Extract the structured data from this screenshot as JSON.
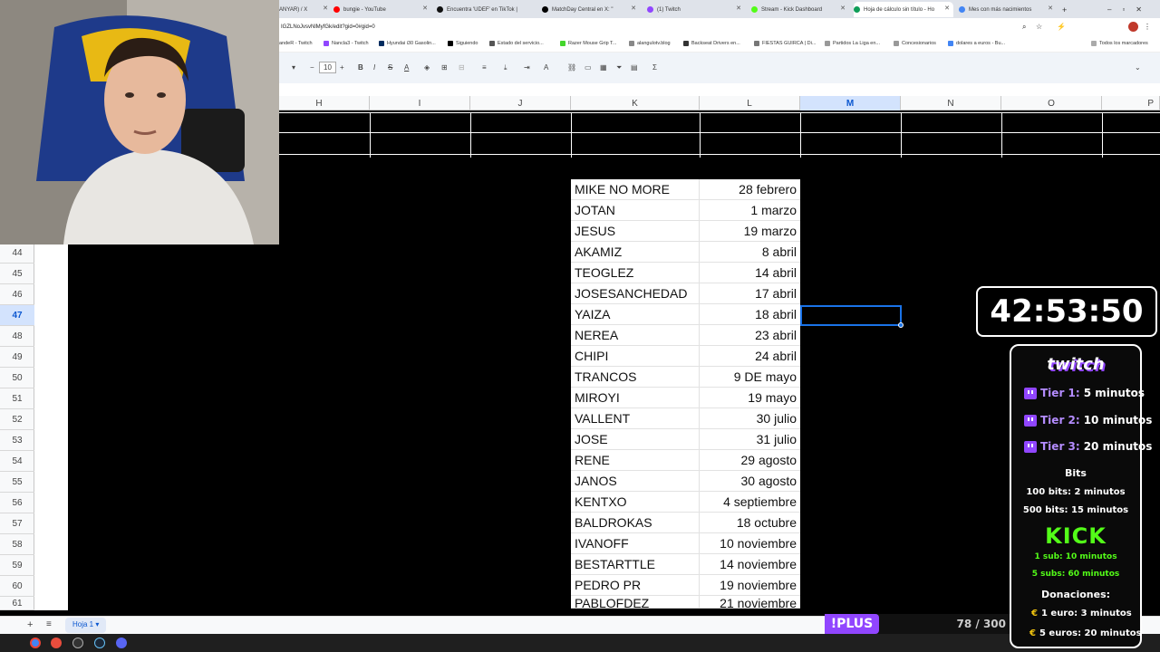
{
  "browser": {
    "tabs": [
      {
        "title": "ANYAR) / X",
        "color": "#000000"
      },
      {
        "title": "bungie - YouTube",
        "color": "#ff0000"
      },
      {
        "title": "Encuentra 'UDEF' en TikTok |",
        "color": "#111111"
      },
      {
        "title": "MatchDay Central en X: \"",
        "color": "#000000"
      },
      {
        "title": "(1) Twitch",
        "color": "#9146ff"
      },
      {
        "title": "Stream - Kick Dashboard",
        "color": "#53fc18"
      },
      {
        "title": "Hoja de cálculo sin título - Ho",
        "color": "#0f9d58"
      },
      {
        "title": "Mes con más nacimientos",
        "color": "#4285f4"
      }
    ],
    "url": "IGZLNoJvsvNlMyfGk/edit?gid=0#gid=0",
    "bookmarks": [
      "andeR - Twitch",
      "Nancla3 - Twitch",
      "Hyundai i30 Gasolin...",
      "Siguiendo",
      "Estado del servicio...",
      "Razer Mouse Grip T...",
      "alangulotv.blog",
      "Backseat Drivers en...",
      "FIESTAS GUIRCA | Di...",
      "Partidos La Liga en...",
      "Concesionarios",
      "dolares a euros - Bu..."
    ],
    "all_bookmarks": "Todos los marcadores"
  },
  "toolbar": {
    "font_size": "10"
  },
  "sheet": {
    "columns": [
      "H",
      "I",
      "J",
      "K",
      "L",
      "M",
      "N",
      "O",
      "P"
    ],
    "selected_column": "M",
    "row_numbers": [
      "44",
      "45",
      "46",
      "47",
      "48",
      "49",
      "50",
      "51",
      "52",
      "53",
      "54",
      "55",
      "56",
      "57",
      "58",
      "59",
      "60",
      "61"
    ],
    "selected_row": "47",
    "entries": [
      {
        "name": "MIKE NO MORE",
        "date": "28 febrero"
      },
      {
        "name": "JOTAN",
        "date": "1 marzo"
      },
      {
        "name": "JESUS",
        "date": "19 marzo"
      },
      {
        "name": "AKAMIZ",
        "date": "8 abril"
      },
      {
        "name": "TEOGLEZ",
        "date": "14 abril"
      },
      {
        "name": "JOSESANCHEDAD",
        "date": "17 abril"
      },
      {
        "name": "YAIZA",
        "date": "18 abril"
      },
      {
        "name": "NEREA",
        "date": "23 abril"
      },
      {
        "name": "CHIPI",
        "date": "24 abril"
      },
      {
        "name": "TRANCOS",
        "date": "9 DE mayo"
      },
      {
        "name": "MIROYI",
        "date": "19 mayo"
      },
      {
        "name": "VALLENT",
        "date": "30 julio"
      },
      {
        "name": "JOSE",
        "date": "31 julio"
      },
      {
        "name": "RENE",
        "date": "29 agosto"
      },
      {
        "name": "JANOS",
        "date": "30 agosto"
      },
      {
        "name": "KENTXO",
        "date": "4 septiembre"
      },
      {
        "name": "BALDROKAS",
        "date": "18 octubre"
      },
      {
        "name": "IVANOFF",
        "date": "10 noviembre"
      },
      {
        "name": "BESTARTTLE",
        "date": "14 noviembre"
      },
      {
        "name": "PEDRO PR",
        "date": "19 noviembre"
      },
      {
        "name": "PABLOFDEZ",
        "date": "21 noviembre"
      }
    ],
    "sheet_tab": "Hoja 1"
  },
  "overlay": {
    "timer": "42:53:50",
    "twitch_logo": "twitch",
    "tiers": [
      {
        "label": "Tier 1:",
        "value": "5 minutos"
      },
      {
        "label": "Tier 2:",
        "value": "10 minutos"
      },
      {
        "label": "Tier 3:",
        "value": "20 minutos"
      }
    ],
    "bits_title": "Bits",
    "bits": [
      "100 bits: 2 minutos",
      "500 bits: 15 minutos"
    ],
    "kick_logo": "KICK",
    "kick": [
      "1 sub: 10 minutos",
      "5 subs: 60 minutos"
    ],
    "donations_title": "Donaciones:",
    "donations": [
      "1 euro: 3 minutos",
      "5 euros: 20 minutos"
    ],
    "plus_label": "!PLUS",
    "plus_count": "78 / 300"
  },
  "colors": {
    "twitch": "#9146ff",
    "kick": "#53fc18",
    "selection": "#1a73e8"
  }
}
